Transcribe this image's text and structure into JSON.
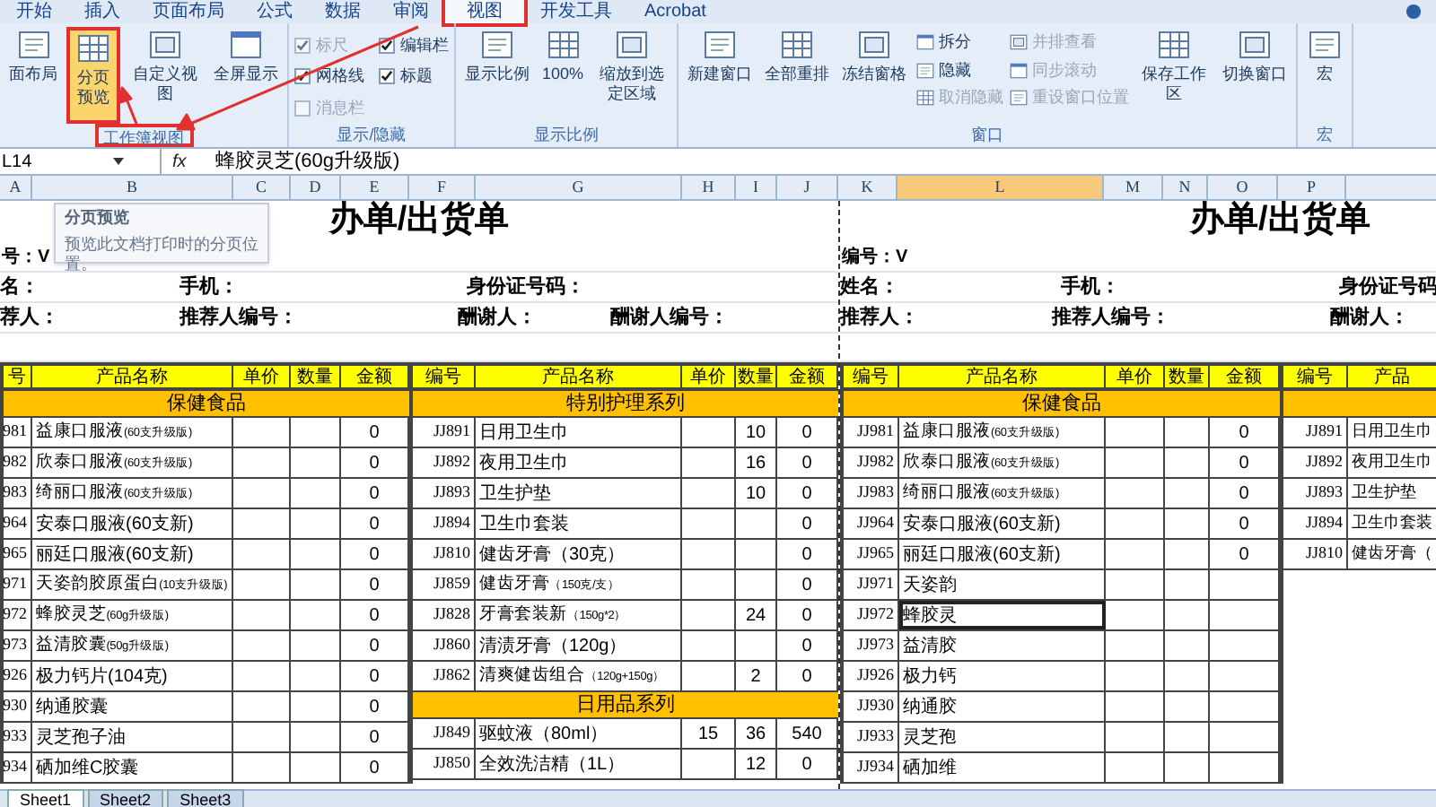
{
  "ribbon": {
    "tabs": [
      {
        "label": "开始",
        "selected": false
      },
      {
        "label": "插入",
        "selected": false
      },
      {
        "label": "页面布局",
        "selected": false
      },
      {
        "label": "公式",
        "selected": false
      },
      {
        "label": "数据",
        "selected": false
      },
      {
        "label": "审阅",
        "selected": false
      },
      {
        "label": "视图",
        "selected": true
      },
      {
        "label": "开发工具",
        "selected": false
      },
      {
        "label": "Acrobat",
        "selected": false
      }
    ],
    "groups": [
      {
        "label": "工作簿视图",
        "items": [
          {
            "kind": "large",
            "label": "面布局",
            "selected": false
          },
          {
            "kind": "large",
            "label": "分页预览",
            "selected": true
          },
          {
            "kind": "large",
            "label": "自定义视图",
            "selected": false
          },
          {
            "kind": "large",
            "label": "全屏显示",
            "selected": false
          }
        ]
      },
      {
        "label": "显示/隐藏",
        "items": [
          {
            "kind": "check",
            "label": "标尺",
            "checked": true,
            "disabled": true
          },
          {
            "kind": "check",
            "label": "网格线",
            "checked": true,
            "disabled": false
          },
          {
            "kind": "check",
            "label": "消息栏",
            "checked": false,
            "disabled": true
          },
          {
            "kind": "check",
            "label": "编辑栏",
            "checked": true,
            "disabled": false
          },
          {
            "kind": "check",
            "label": "标题",
            "checked": true,
            "disabled": false
          }
        ]
      },
      {
        "label": "显示比例",
        "items": [
          {
            "kind": "large",
            "label": "显示比例",
            "selected": false
          },
          {
            "kind": "large",
            "label": "100%",
            "selected": false
          },
          {
            "kind": "large",
            "label": "缩放到选定区域",
            "selected": false
          }
        ]
      },
      {
        "label": "窗口",
        "items": [
          {
            "kind": "large",
            "label": "新建窗口",
            "selected": false
          },
          {
            "kind": "large",
            "label": "全部重排",
            "selected": false
          },
          {
            "kind": "large",
            "label": "冻结窗格",
            "selected": false
          },
          {
            "kind": "small",
            "label": "拆分",
            "disabled": false
          },
          {
            "kind": "small",
            "label": "隐藏",
            "disabled": false
          },
          {
            "kind": "small",
            "label": "取消隐藏",
            "disabled": true
          },
          {
            "kind": "small",
            "label": "并排查看",
            "disabled": true
          },
          {
            "kind": "small",
            "label": "同步滚动",
            "disabled": true
          },
          {
            "kind": "small",
            "label": "重设窗口位置",
            "disabled": true
          },
          {
            "kind": "large",
            "label": "保存工作区",
            "selected": false
          },
          {
            "kind": "large",
            "label": "切换窗口",
            "selected": false
          }
        ]
      },
      {
        "label": "宏",
        "items": [
          {
            "kind": "large",
            "label": "宏",
            "selected": false
          }
        ]
      }
    ]
  },
  "formula_bar": {
    "name_box": "L14",
    "fx": "fx",
    "value": "蜂胶灵芝(60g升级版)"
  },
  "tooltip": {
    "title": "分页预览",
    "text": "预览此文档打印时的分页位置。"
  },
  "column_headers": [
    {
      "label": "A",
      "selected": false
    },
    {
      "label": "B",
      "selected": false
    },
    {
      "label": "C",
      "selected": false
    },
    {
      "label": "D",
      "selected": false
    },
    {
      "label": "E",
      "selected": false
    },
    {
      "label": "F",
      "selected": false
    },
    {
      "label": "G",
      "selected": false
    },
    {
      "label": "H",
      "selected": false
    },
    {
      "label": "I",
      "selected": false
    },
    {
      "label": "J",
      "selected": false
    },
    {
      "label": "K",
      "selected": false
    },
    {
      "label": "L",
      "selected": true
    },
    {
      "label": "M",
      "selected": false
    },
    {
      "label": "N",
      "selected": false
    },
    {
      "label": "O",
      "selected": false
    },
    {
      "label": "P",
      "selected": false
    }
  ],
  "pages": [
    {
      "title": "办单/出货单",
      "number": "号：V",
      "info_rows": [
        [
          "名：",
          "手机：",
          "身份证号码："
        ],
        [
          "荐人：",
          "推荐人编号：",
          "酬谢人：",
          "酬谢人编号："
        ]
      ],
      "tables": [
        {
          "header": [
            "号",
            "产品名称",
            "单价",
            "数量",
            "金额"
          ],
          "sections": [
            {
              "title": "保健食品",
              "rows": [
                {
                  "code": "981",
                  "name": "益康口服液(60支升级版)",
                  "amount": "0",
                  "selected": false
                },
                {
                  "code": "982",
                  "name": "欣泰口服液(60支升级版)",
                  "amount": "0",
                  "selected": false
                },
                {
                  "code": "983",
                  "name": "绮丽口服液(60支升级版)",
                  "amount": "0",
                  "selected": false
                },
                {
                  "code": "964",
                  "name": "安泰口服液(60支新)",
                  "amount": "0",
                  "selected": false
                },
                {
                  "code": "965",
                  "name": "丽廷口服液(60支新)",
                  "amount": "0",
                  "selected": false
                },
                {
                  "code": "971",
                  "name": "天姿韵胶原蛋白(10支升级版)",
                  "amount": "0",
                  "selected": false
                },
                {
                  "code": "972",
                  "name": "蜂胶灵芝(60g升级版)",
                  "amount": "0",
                  "selected": false
                },
                {
                  "code": "973",
                  "name": "益清胶囊(50g升级版)",
                  "amount": "0",
                  "selected": false
                },
                {
                  "code": "926",
                  "name": "极力钙片(104克)",
                  "amount": "0",
                  "selected": false
                },
                {
                  "code": "930",
                  "name": "纳通胶囊",
                  "amount": "0",
                  "selected": false
                },
                {
                  "code": "933",
                  "name": "灵芝孢子油",
                  "amount": "0",
                  "selected": false
                },
                {
                  "code": "934",
                  "name": "硒加维C胶囊",
                  "amount": "0",
                  "selected": false
                }
              ]
            }
          ]
        },
        {
          "header": [
            "编号",
            "产品名称",
            "单价",
            "数量",
            "金额"
          ],
          "sections": [
            {
              "title": "特别护理系列",
              "rows": [
                {
                  "code": "JJ891",
                  "name": "日用卫生巾",
                  "qty": "10",
                  "amount": "0",
                  "selected": false
                },
                {
                  "code": "JJ892",
                  "name": "夜用卫生巾",
                  "qty": "16",
                  "amount": "0",
                  "selected": false
                },
                {
                  "code": "JJ893",
                  "name": "卫生护垫",
                  "qty": "10",
                  "amount": "0",
                  "selected": false
                },
                {
                  "code": "JJ894",
                  "name": "卫生巾套装",
                  "amount": "0",
                  "selected": false
                },
                {
                  "code": "JJ810",
                  "name": "健齿牙膏（30克）",
                  "amount": "0",
                  "selected": false
                },
                {
                  "code": "JJ859",
                  "name": "健齿牙膏（150克/支）",
                  "amount": "0",
                  "selected": false
                },
                {
                  "code": "JJ828",
                  "name": "牙膏套装新（150g*2）",
                  "qty": "24",
                  "amount": "0",
                  "selected": false
                },
                {
                  "code": "JJ860",
                  "name": "清渍牙膏（120g）",
                  "amount": "0",
                  "selected": false
                },
                {
                  "code": "JJ862",
                  "name": "清爽健齿组合（120g+150g）",
                  "qty": "2",
                  "amount": "0",
                  "selected": false
                }
              ]
            },
            {
              "title": "日用品系列",
              "rows": [
                {
                  "code": "JJ849",
                  "name": "驱蚊液（80ml）",
                  "price": "15",
                  "qty": "36",
                  "amount": "540",
                  "selected": false
                },
                {
                  "code": "JJ850",
                  "name": "全效洗洁精（1L）",
                  "qty": "12",
                  "amount": "0",
                  "selected": false
                }
              ]
            }
          ]
        }
      ]
    },
    {
      "title": "办单/出货单",
      "number": "编号：V",
      "info_rows": [
        [
          "姓名：",
          "手机：",
          "身份证号码"
        ],
        [
          "推荐人：",
          "推荐人编号：",
          "酬谢人："
        ]
      ],
      "tables": [
        {
          "header": [
            "编号",
            "产品名称",
            "单价",
            "数量",
            "金额"
          ],
          "sections": [
            {
              "title": "保健食品",
              "rows": [
                {
                  "code": "JJ981",
                  "name": "益康口服液(60支升级版)",
                  "amount": "0",
                  "selected": false
                },
                {
                  "code": "JJ982",
                  "name": "欣泰口服液(60支升级版)",
                  "amount": "0",
                  "selected": false
                },
                {
                  "code": "JJ983",
                  "name": "绮丽口服液(60支升级版)",
                  "amount": "0",
                  "selected": false
                },
                {
                  "code": "JJ964",
                  "name": "安泰口服液(60支新)",
                  "amount": "0",
                  "selected": false
                },
                {
                  "code": "JJ965",
                  "name": "丽廷口服液(60支新)",
                  "amount": "0",
                  "selected": false
                },
                {
                  "code": "JJ971",
                  "name": "天姿韵",
                  "selected": false
                },
                {
                  "code": "JJ972",
                  "name": "蜂胶灵",
                  "selected": true
                },
                {
                  "code": "JJ973",
                  "name": "益清胶",
                  "selected": false
                },
                {
                  "code": "JJ926",
                  "name": "极力钙",
                  "selected": false
                },
                {
                  "code": "JJ930",
                  "name": "纳通胶",
                  "selected": false
                },
                {
                  "code": "JJ933",
                  "name": "灵芝孢",
                  "selected": false
                },
                {
                  "code": "JJ934",
                  "name": "硒加维",
                  "selected": false
                }
              ]
            }
          ]
        },
        {
          "header": [
            "编号",
            "产品"
          ],
          "sections": [
            {
              "rows": [
                {
                  "code": "JJ891",
                  "name": "日用卫生巾",
                  "selected": false
                },
                {
                  "code": "JJ892",
                  "name": "夜用卫生巾",
                  "selected": false
                },
                {
                  "code": "JJ893",
                  "name": "卫生护垫",
                  "selected": false
                },
                {
                  "code": "JJ894",
                  "name": "卫生巾套装",
                  "selected": false
                },
                {
                  "code": "JJ810",
                  "name": "健齿牙膏（",
                  "selected": false
                }
              ]
            }
          ]
        }
      ]
    }
  ],
  "sheet_tabs": [
    {
      "label": "Sheet1",
      "selected": true
    },
    {
      "label": "Sheet2",
      "selected": false
    },
    {
      "label": "Sheet3",
      "selected": false
    }
  ]
}
